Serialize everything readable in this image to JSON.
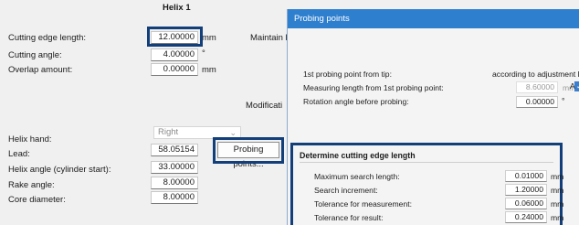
{
  "main": {
    "column_header": "Helix 1",
    "cutting_edge_length": {
      "label": "Cutting edge length:",
      "value": "12.00000",
      "unit": "mm"
    },
    "cutting_angle": {
      "label": "Cutting angle:",
      "value": "4.00000",
      "unit": "°"
    },
    "overlap_amount": {
      "label": "Overlap amount:",
      "value": "0.00000",
      "unit": "mm"
    },
    "maintain_label": "Maintain le",
    "modification_label": "Modificati",
    "helix_hand": {
      "label": "Helix hand:",
      "value": "Right"
    },
    "lead": {
      "label": "Lead:",
      "value": "58.05154"
    },
    "helix_angle": {
      "label": "Helix angle (cylinder start):",
      "value": "33.00000"
    },
    "rake_angle": {
      "label": "Rake angle:",
      "value": "8.00000"
    },
    "core_diameter": {
      "label": "Core diameter:",
      "value": "8.00000"
    },
    "probing_points_button": "Probing points..."
  },
  "dialog": {
    "title": "Probing points",
    "first_point": {
      "label": "1st probing point from tip:",
      "value": "according to adjustment ler"
    },
    "measuring_length": {
      "label": "Measuring length from 1st probing point:",
      "value": "8.60000",
      "unit": "mm",
      "check_label": "A"
    },
    "rotation_angle": {
      "label": "Rotation angle before probing:",
      "value": "0.00000",
      "unit": "°"
    },
    "group": {
      "title": "Determine cutting edge length",
      "max_search": {
        "label": "Maximum search length:",
        "value": "0.01000",
        "unit": "mm"
      },
      "search_increment": {
        "label": "Search increment:",
        "value": "1.20000",
        "unit": "mm"
      },
      "tol_measurement": {
        "label": "Tolerance for measurement:",
        "value": "0.06000",
        "unit": "mm"
      },
      "tol_result": {
        "label": "Tolerance for result:",
        "value": "0.24000",
        "unit": "mm"
      }
    }
  },
  "colors": {
    "accent": "#123f7a",
    "titlebar": "#2f7fcf"
  }
}
